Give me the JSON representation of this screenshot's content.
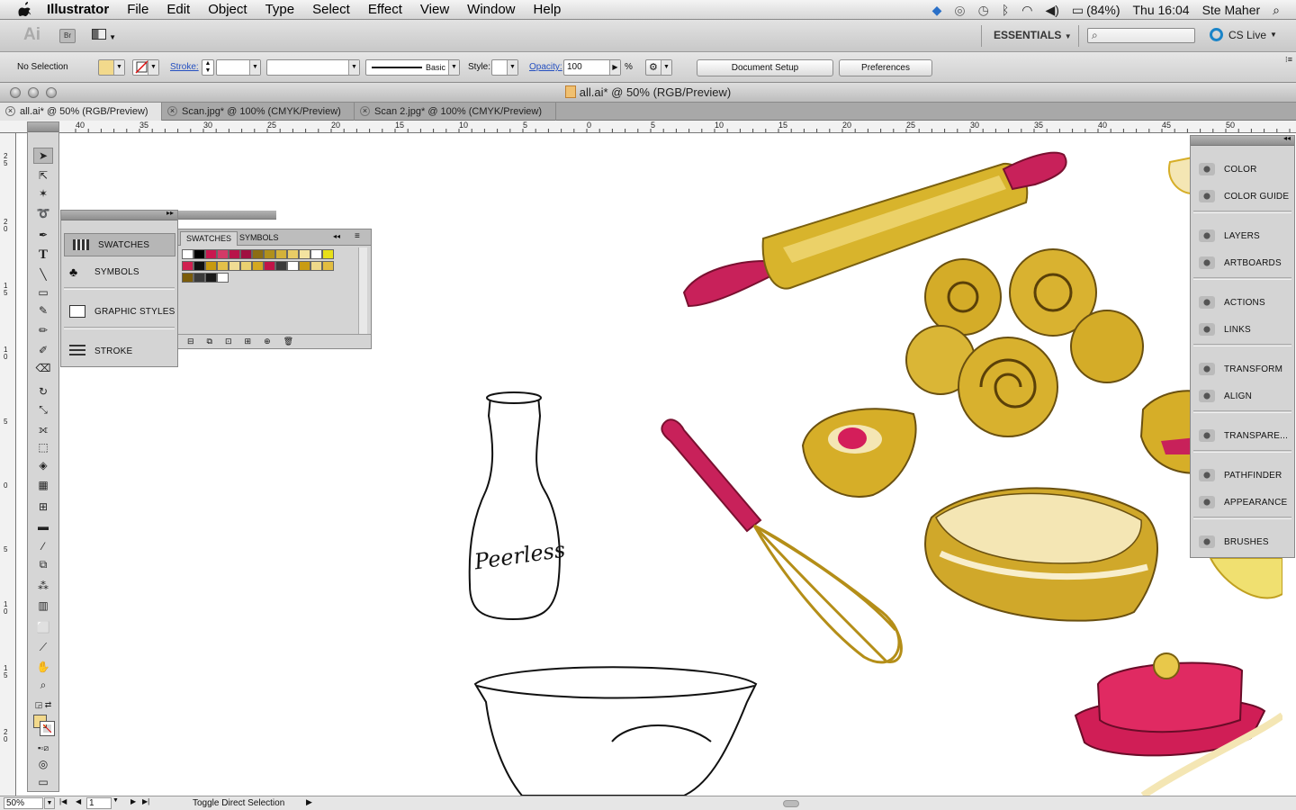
{
  "menubar": {
    "app_name": "Illustrator",
    "menus": [
      "File",
      "Edit",
      "Object",
      "Type",
      "Select",
      "Effect",
      "View",
      "Window",
      "Help"
    ],
    "battery": "(84%)",
    "clock": "Thu 16:04",
    "user": "Ste Maher"
  },
  "appbar": {
    "logo": "Ai",
    "bridge_label": "Br",
    "workspace": "ESSENTIALS",
    "cs_live": "CS Live"
  },
  "control": {
    "selection": "No Selection",
    "stroke_label": "Stroke:",
    "brush_label": "Basic",
    "style_label": "Style:",
    "opacity_label": "Opacity:",
    "opacity_value": "100",
    "percent": "%",
    "doc_setup": "Document Setup",
    "preferences": "Preferences"
  },
  "window": {
    "title": "all.ai* @ 50% (RGB/Preview)"
  },
  "tabs": [
    {
      "label": "all.ai* @ 50% (RGB/Preview)"
    },
    {
      "label": "Scan.jpg* @ 100% (CMYK/Preview)"
    },
    {
      "label": "Scan 2.jpg* @ 100% (CMYK/Preview)"
    }
  ],
  "ruler_h": [
    "40",
    "35",
    "30",
    "25",
    "20",
    "15",
    "10",
    "5",
    "0",
    "5",
    "10",
    "15",
    "20",
    "25",
    "30",
    "35",
    "40",
    "45",
    "50"
  ],
  "ruler_v": [
    "2 5",
    "2 0",
    "1 5",
    "1 0",
    "5",
    "0",
    "5",
    "1 0",
    "1 5",
    "2 0"
  ],
  "left_dock": {
    "items": [
      {
        "label": "SWATCHES",
        "icon": "swatches-icon"
      },
      {
        "label": "SYMBOLS",
        "icon": "symbols-icon"
      },
      {
        "label": "GRAPHIC STYLES",
        "icon": "graphic-styles-icon"
      },
      {
        "label": "STROKE",
        "icon": "stroke-icon"
      }
    ]
  },
  "swatches_panel": {
    "tabs": [
      "SWATCHES",
      "SYMBOLS"
    ],
    "colors": [
      "#ffffff",
      "#000000",
      "#c8174f",
      "#d23a67",
      "#b8144a",
      "#a01040",
      "#8c6d14",
      "#b0901c",
      "#d4b23a",
      "#e8cc66",
      "#f3e3a0",
      "#ffffff",
      "#e8e018",
      "#d02050",
      "#101010",
      "#c79a10",
      "#e4c04a",
      "#f0dc94",
      "#e9d070",
      "#d3a820",
      "#c01448",
      "#3a3a3a",
      "#ffffff",
      "#c99c12",
      "#efd98a",
      "#e2bd40",
      "#7b5c0a",
      "#3b3b3b",
      "#1a1a1a",
      "#ffffff"
    ]
  },
  "right_dock": {
    "items": [
      {
        "label": "COLOR",
        "icon": "color-icon"
      },
      {
        "label": "COLOR GUIDE",
        "icon": "color-guide-icon"
      },
      {
        "label": "LAYERS",
        "icon": "layers-icon"
      },
      {
        "label": "ARTBOARDS",
        "icon": "artboards-icon"
      },
      {
        "label": "ACTIONS",
        "icon": "actions-icon"
      },
      {
        "label": "LINKS",
        "icon": "links-icon"
      },
      {
        "label": "TRANSFORM",
        "icon": "transform-icon"
      },
      {
        "label": "ALIGN",
        "icon": "align-icon"
      },
      {
        "label": "TRANSPARE...",
        "icon": "transparency-icon"
      },
      {
        "label": "PATHFINDER",
        "icon": "pathfinder-icon"
      },
      {
        "label": "APPEARANCE",
        "icon": "appearance-icon"
      },
      {
        "label": "BRUSHES",
        "icon": "brushes-icon"
      }
    ]
  },
  "artwork": {
    "bottle_label": "Peerless"
  },
  "status": {
    "zoom": "50%",
    "artboard": "1",
    "tool_hint": "Toggle Direct Selection"
  },
  "colors": {
    "pink": "#c81e58",
    "gold": "#d6ae28",
    "cream": "#f4e6b4",
    "ui_gray": "#d4d4d4"
  }
}
